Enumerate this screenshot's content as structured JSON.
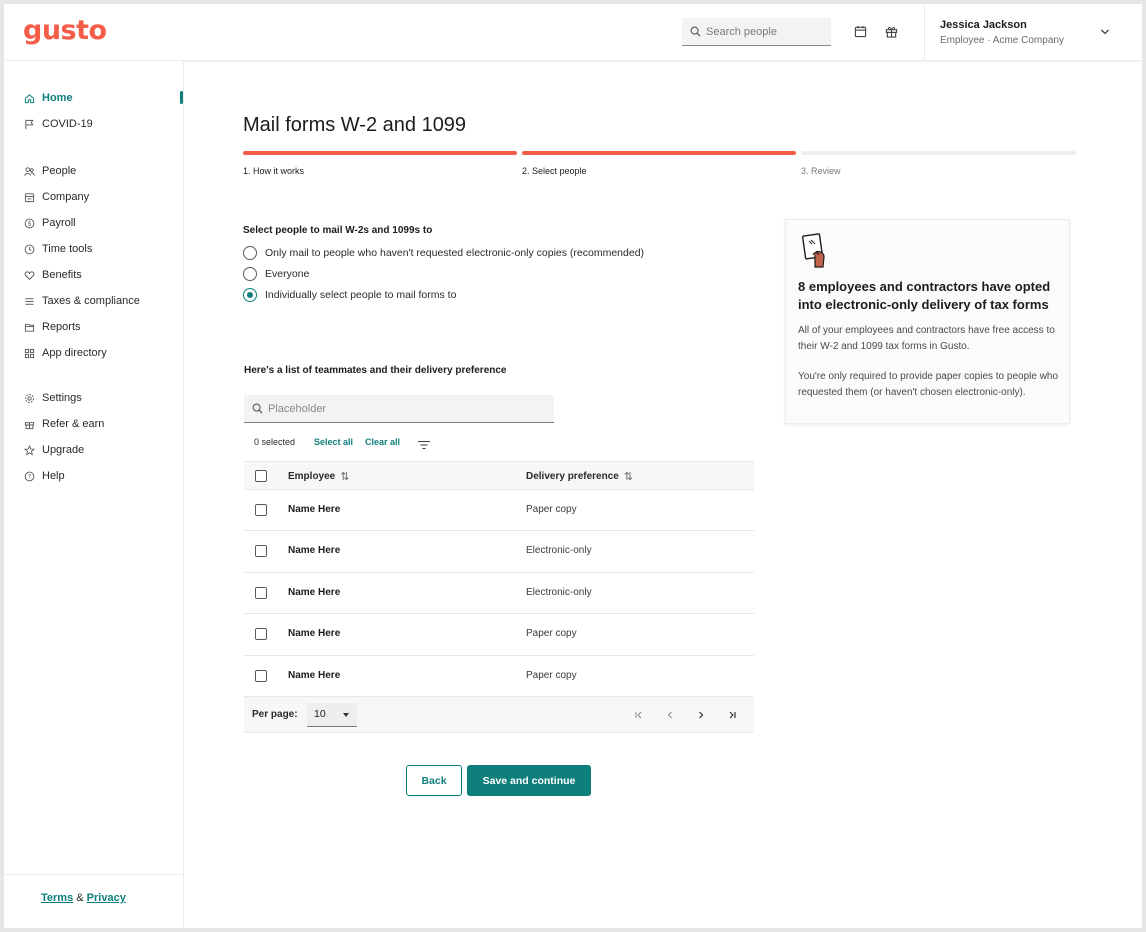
{
  "header": {
    "logo": "gusto",
    "search_placeholder": "Search people",
    "user_name": "Jessica Jackson",
    "user_subtitle": "Employee · Acme Company"
  },
  "sidebar": {
    "items": [
      {
        "label": "Home",
        "icon": "home-icon",
        "active": true
      },
      {
        "label": "COVID-19",
        "icon": "flag-icon"
      },
      {
        "label": "People",
        "icon": "people-icon"
      },
      {
        "label": "Company",
        "icon": "building-icon"
      },
      {
        "label": "Payroll",
        "icon": "dollar-icon"
      },
      {
        "label": "Time tools",
        "icon": "clock-icon"
      },
      {
        "label": "Benefits",
        "icon": "heart-icon"
      },
      {
        "label": "Taxes & compliance",
        "icon": "list-icon"
      },
      {
        "label": "Reports",
        "icon": "folder-icon"
      },
      {
        "label": "App directory",
        "icon": "grid-icon"
      },
      {
        "label": "Settings",
        "icon": "gear-icon"
      },
      {
        "label": "Refer & earn",
        "icon": "gift-icon"
      },
      {
        "label": "Upgrade",
        "icon": "star-icon"
      },
      {
        "label": "Help",
        "icon": "help-icon"
      }
    ],
    "footer": {
      "terms": "Terms",
      "amp": "&",
      "privacy": "Privacy"
    }
  },
  "main": {
    "title": "Mail forms W-2 and 1099",
    "steps": [
      {
        "label": "1. How it works",
        "state": "complete"
      },
      {
        "label": "2. Select people",
        "state": "current"
      },
      {
        "label": "3. Review",
        "state": "upcoming"
      }
    ],
    "select_label": "Select people to mail W-2s and 1099s to",
    "radio_options": [
      {
        "label": "Only mail to people who haven't requested electronic-only copies (recommended)",
        "checked": false
      },
      {
        "label": "Everyone",
        "checked": false
      },
      {
        "label": "Individually select people to mail forms to",
        "checked": true
      }
    ],
    "list_label": "Here's a list of teammates and their delivery preference",
    "filter_placeholder": "Placeholder",
    "selected_count": "0 selected",
    "select_all": "Select all",
    "clear_all": "Clear all",
    "table": {
      "columns": [
        "Employee",
        "Delivery preference"
      ],
      "rows": [
        {
          "name": "Name Here",
          "preference": "Paper copy"
        },
        {
          "name": "Name Here",
          "preference": "Electronic-only"
        },
        {
          "name": "Name Here",
          "preference": "Electronic-only"
        },
        {
          "name": "Name Here",
          "preference": "Paper copy"
        },
        {
          "name": "Name Here",
          "preference": "Paper copy"
        }
      ],
      "per_page_label": "Per page:",
      "per_page_value": "10"
    },
    "back_label": "Back",
    "save_label": "Save and continue"
  },
  "info_card": {
    "title": "8 employees and contractors have opted into electronic-only delivery of tax forms",
    "paragraph1": "All of your employees and contractors have free access to their W-2 and 1099 tax forms in Gusto.",
    "paragraph2": "You're only required to provide paper copies to people who requested them (or haven't chosen electronic-only)."
  },
  "colors": {
    "brand": "#f45d48",
    "accent": "#0f7f7c",
    "progress_incomplete": "#efefef"
  }
}
